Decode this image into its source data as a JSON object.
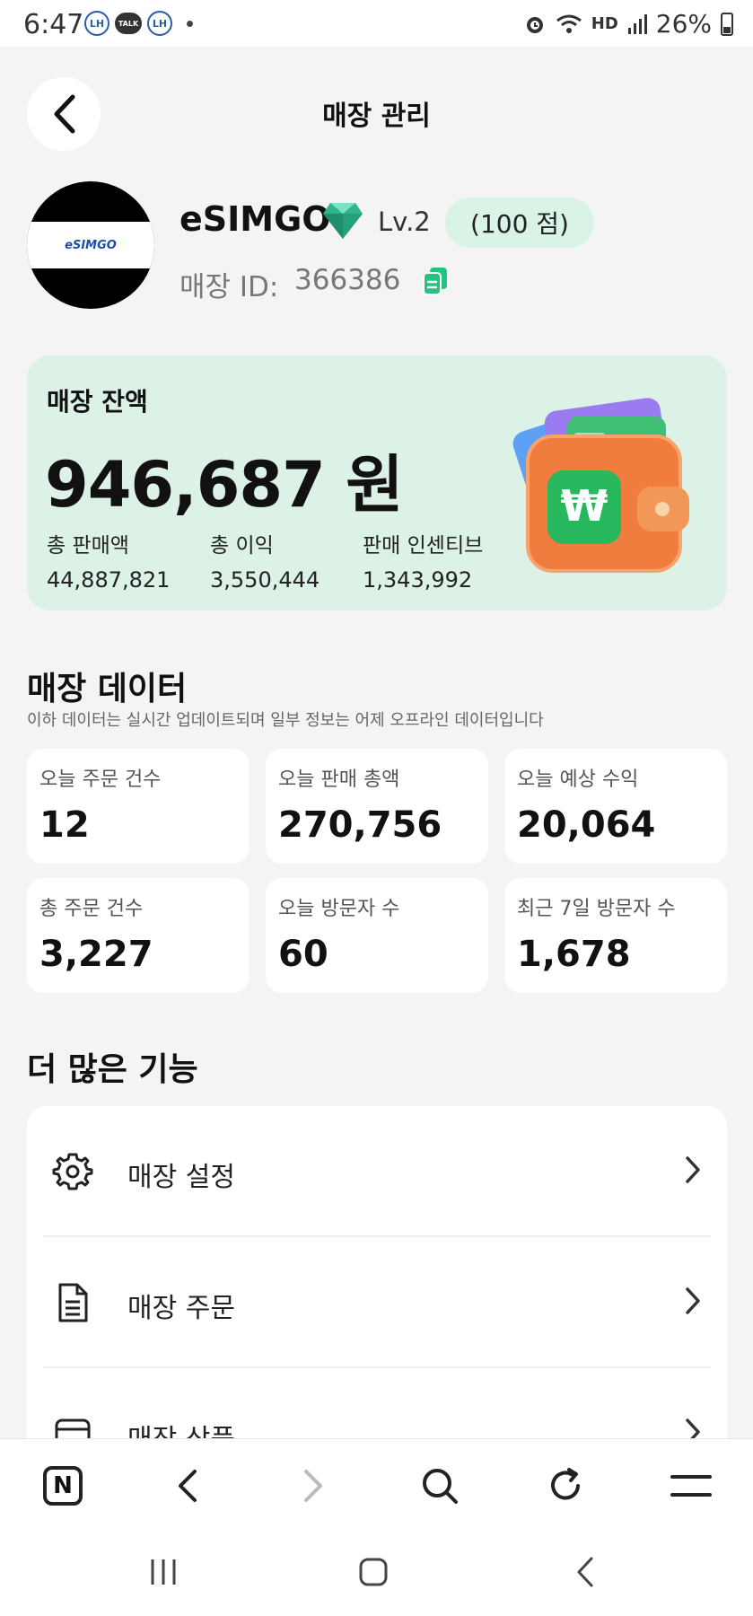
{
  "status_bar": {
    "time": "6:47",
    "app_badge_1": "LH",
    "talk_badge": "TALK",
    "app_badge_2": "LH",
    "network_label": "HD",
    "battery": "26%"
  },
  "header": {
    "title": "매장 관리"
  },
  "profile": {
    "name": "eSIMGO",
    "level": "Lv.2",
    "points": "(100 점)",
    "id_label": "매장 ID:",
    "id_value": "366386",
    "logo_text": "eSIMGO"
  },
  "balance": {
    "label": "매장 잔액",
    "amount": "946,687 원",
    "stats": [
      {
        "label": "총 판매액",
        "value": "44,887,821"
      },
      {
        "label": "총 이익",
        "value": "3,550,444"
      },
      {
        "label": "판매 인센티브",
        "value": "1,343,992"
      }
    ],
    "wallet_symbol": "₩"
  },
  "store_data": {
    "title": "매장 데이터",
    "subtitle": "이하 데이터는 실시간 업데이트되며 일부 정보는 어제 오프라인 데이터입니다",
    "cards": [
      {
        "label": "오늘 주문 건수",
        "value": "12"
      },
      {
        "label": "오늘 판매 총액",
        "value": "270,756"
      },
      {
        "label": "오늘 예상 수익",
        "value": "20,064"
      },
      {
        "label": "총 주문 건수",
        "value": "3,227"
      },
      {
        "label": "오늘 방문자 수",
        "value": "60"
      },
      {
        "label": "최근 7일 방문자 수",
        "value": "1,678"
      }
    ]
  },
  "more_features": {
    "title": "더 많은 기능",
    "items": [
      {
        "label": "매장 설정",
        "icon": "gear-icon"
      },
      {
        "label": "매장 주문",
        "icon": "document-icon"
      },
      {
        "label": "매장 상품",
        "icon": "box-icon"
      }
    ]
  },
  "browser_bar": {
    "home_label": "N"
  },
  "colors": {
    "accent_green": "#26c281",
    "card_bg": "#dcf2e6",
    "badge_bg": "#d9f3e6"
  }
}
